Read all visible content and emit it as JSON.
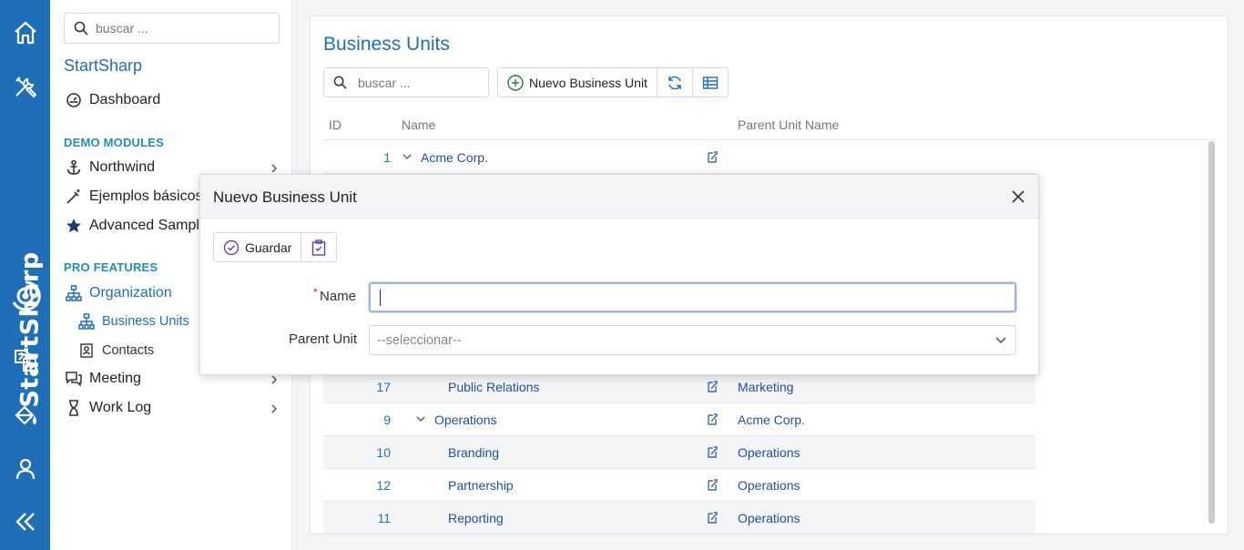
{
  "rail": {
    "brand": "StartSharp",
    "icons": [
      "home-icon",
      "tools-icon",
      "translate-icon",
      "paint-bucket-icon",
      "user-icon",
      "collapse-icon"
    ]
  },
  "sidebar": {
    "search_placeholder": "buscar ...",
    "app_title": "StartSharp",
    "dashboard": "Dashboard",
    "demo_header": "DEMO MODULES",
    "northwind": "Northwind",
    "ejemplos": "Ejemplos básicos",
    "advanced": "Advanced Samples",
    "pro_header": "PRO FEATURES",
    "organization": "Organization",
    "business_units": "Business Units",
    "contacts": "Contacts",
    "meeting": "Meeting",
    "work_log": "Work Log"
  },
  "main": {
    "title": "Business Units",
    "search_placeholder": "buscar ...",
    "new_button": "Nuevo Business Unit",
    "columns": {
      "id": "ID",
      "name": "Name",
      "parent": "Parent Unit Name"
    },
    "rows": [
      {
        "id": "1",
        "name": "Acme Corp.",
        "parent": ""
      },
      {
        "id": "17",
        "name": "Public Relations",
        "parent": "Marketing"
      },
      {
        "id": "9",
        "name": "Operations",
        "parent": "Acme Corp."
      },
      {
        "id": "10",
        "name": "Branding",
        "parent": "Operations"
      },
      {
        "id": "12",
        "name": "Partnership",
        "parent": "Operations"
      },
      {
        "id": "11",
        "name": "Reporting",
        "parent": "Operations"
      }
    ]
  },
  "dialog": {
    "title": "Nuevo Business Unit",
    "save_label": "Guardar",
    "name_label": "Name",
    "required_mark": "*",
    "name_value": "",
    "parent_label": "Parent Unit",
    "parent_placeholder": "--seleccionar--"
  },
  "colors": {
    "rail": "#1f6fb8",
    "link": "#1f4fa0",
    "accent": "#1f6fb8"
  }
}
